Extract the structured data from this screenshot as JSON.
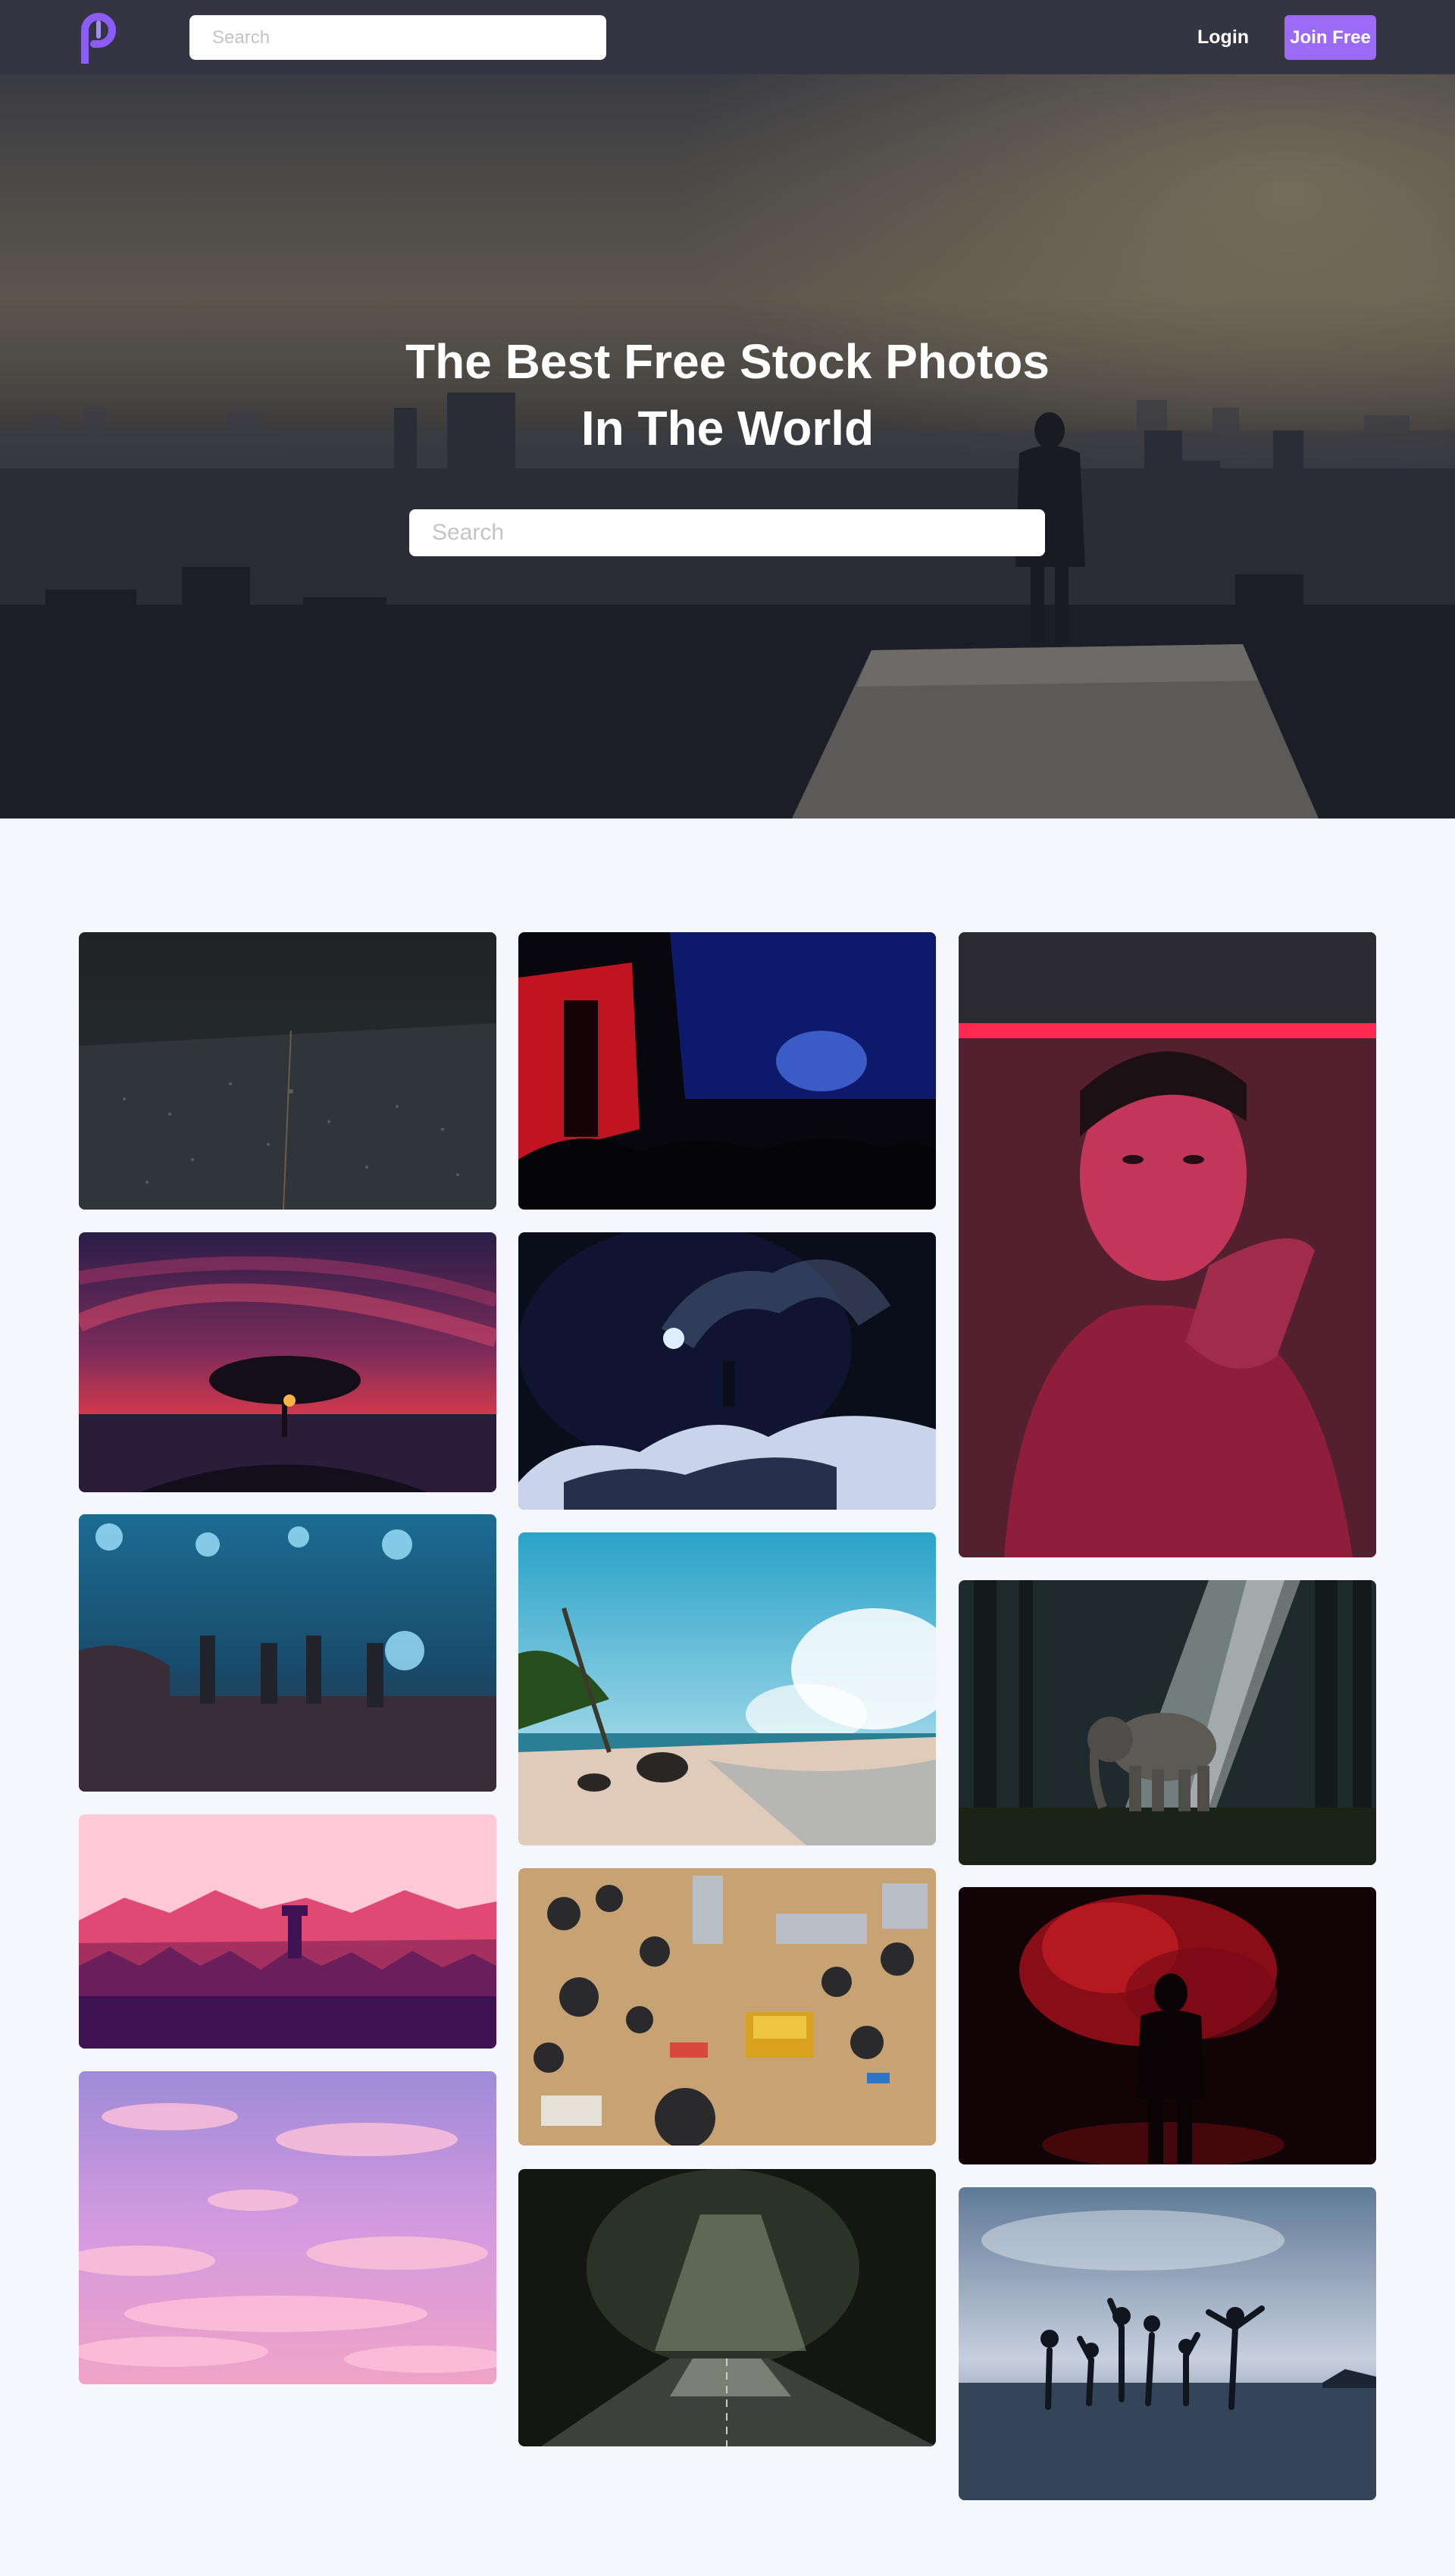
{
  "navbar": {
    "search_placeholder": "Search",
    "login_label": "Login",
    "join_label": "Join Free",
    "accent_color": "#9b6bf7"
  },
  "hero": {
    "title_line1": "The Best Free Stock Photos",
    "title_line2": "In The World",
    "search_placeholder": "Search"
  },
  "gallery": {
    "columns": [
      [
        "city-night-aerial",
        "tree-sunset-red-sky",
        "concert-blue-lights",
        "pink-mountains-illustration",
        "pink-purple-clouds"
      ],
      [
        "red-blue-club-crowd",
        "smoke-flare-snowy-mountain",
        "tropical-beach",
        "circuit-board-components",
        "forest-road-light"
      ],
      [
        "man-red-neon-portrait",
        "elephant-forest-light",
        "red-smoke-silhouette",
        "group-jumping-beach"
      ]
    ]
  }
}
